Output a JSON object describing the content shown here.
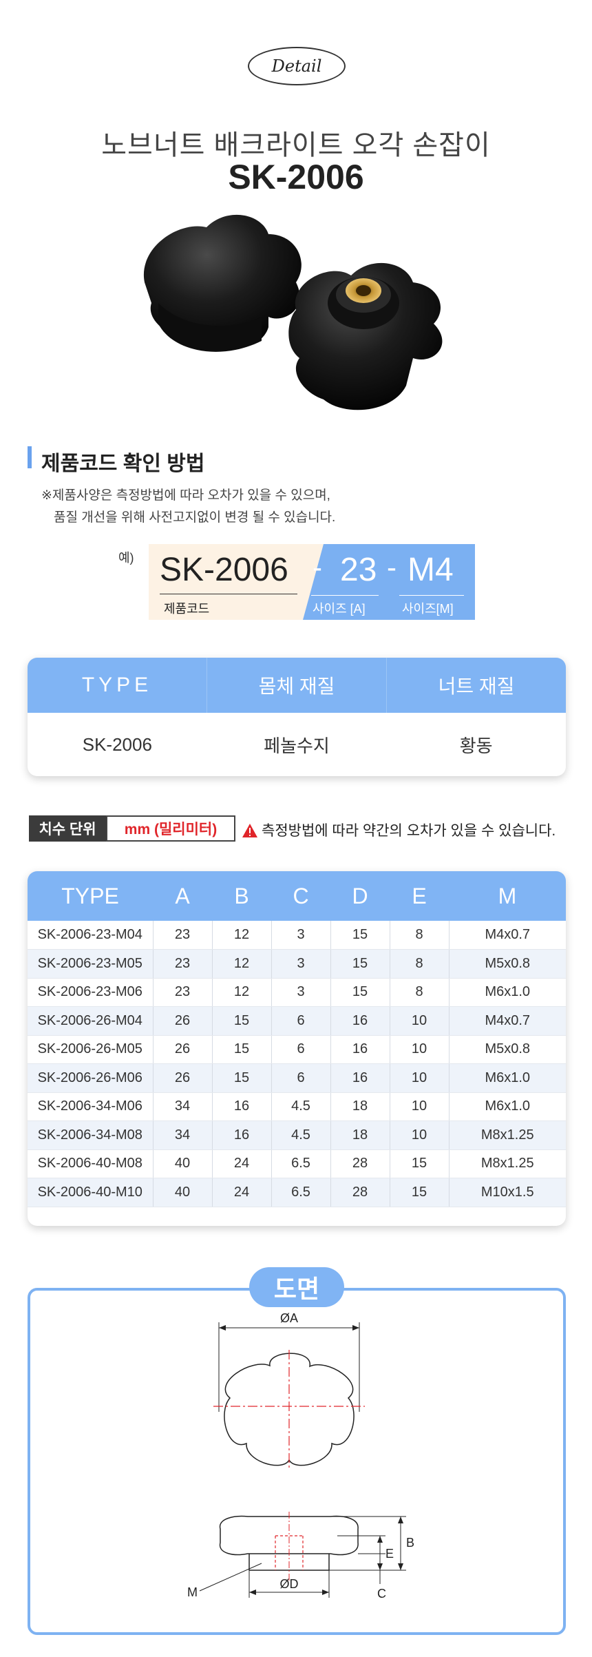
{
  "header": {
    "badge": "Detail",
    "title_kr": "노브너트 배크라이트 오각 손잡이",
    "title_code": "SK-2006"
  },
  "code_section": {
    "title": "제품코드 확인 방법",
    "note_line1": "※제품사양은 측정방법에 따라 오차가 있을 수 있으며,",
    "note_line2": "품질 개선을 위해 사전고지없이 변경 될 수 있습니다.",
    "example_label": "예)",
    "example_code": "SK-2006",
    "example_code_label": "제품코드",
    "dash": "-",
    "example_size_a": "23",
    "example_size_m": "M4",
    "size_a_label": "사이즈 [A]",
    "size_m_label": "사이즈[M]"
  },
  "material_table": {
    "headers": [
      "TYPE",
      "몸체 재질",
      "너트 재질"
    ],
    "row": [
      "SK-2006",
      "페놀수지",
      "황동"
    ]
  },
  "unit_bar": {
    "label": "치수 단위",
    "unit": "mm (밀리미터)",
    "warning": "측정방법에 따라 약간의 오차가 있을 수 있습니다.",
    "warning_icon": "warning-triangle-icon",
    "warning_color": "#e0252a"
  },
  "size_table": {
    "headers": [
      "TYPE",
      "A",
      "B",
      "C",
      "D",
      "E",
      "M"
    ],
    "rows": [
      [
        "SK-2006-23-M04",
        "23",
        "12",
        "3",
        "15",
        "8",
        "M4x0.7"
      ],
      [
        "SK-2006-23-M05",
        "23",
        "12",
        "3",
        "15",
        "8",
        "M5x0.8"
      ],
      [
        "SK-2006-23-M06",
        "23",
        "12",
        "3",
        "15",
        "8",
        "M6x1.0"
      ],
      [
        "SK-2006-26-M04",
        "26",
        "15",
        "6",
        "16",
        "10",
        "M4x0.7"
      ],
      [
        "SK-2006-26-M05",
        "26",
        "15",
        "6",
        "16",
        "10",
        "M5x0.8"
      ],
      [
        "SK-2006-26-M06",
        "26",
        "15",
        "6",
        "16",
        "10",
        "M6x1.0"
      ],
      [
        "SK-2006-34-M06",
        "34",
        "16",
        "4.5",
        "18",
        "10",
        "M6x1.0"
      ],
      [
        "SK-2006-34-M08",
        "34",
        "16",
        "4.5",
        "18",
        "10",
        "M8x1.25"
      ],
      [
        "SK-2006-40-M08",
        "40",
        "24",
        "6.5",
        "28",
        "15",
        "M8x1.25"
      ],
      [
        "SK-2006-40-M10",
        "40",
        "24",
        "6.5",
        "28",
        "15",
        "M10x1.5"
      ]
    ]
  },
  "drawing": {
    "title": "도면",
    "dim_a": "ØA",
    "dim_d": "ØD",
    "dim_b": "B",
    "dim_e": "E",
    "dim_c": "C",
    "dim_m": "M"
  },
  "colors": {
    "accent_blue": "#80b4f4",
    "code_bg": "#fdf2e4",
    "unit_red": "#e0252a"
  }
}
